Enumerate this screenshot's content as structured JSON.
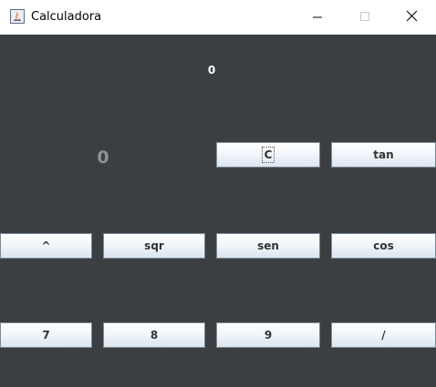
{
  "window": {
    "title": "Calculadora"
  },
  "display": {
    "expression": "0",
    "result": "0"
  },
  "buttons": {
    "clear": "C",
    "tan": "tan",
    "power": "^",
    "sqr": "sqr",
    "sen": "sen",
    "cos": "cos",
    "seven": "7",
    "eight": "8",
    "nine": "9",
    "divide": "/"
  },
  "colors": {
    "panel_background": "#3c3f41",
    "display_top_text": "#ffffff",
    "display_main_text": "#8e9296"
  }
}
